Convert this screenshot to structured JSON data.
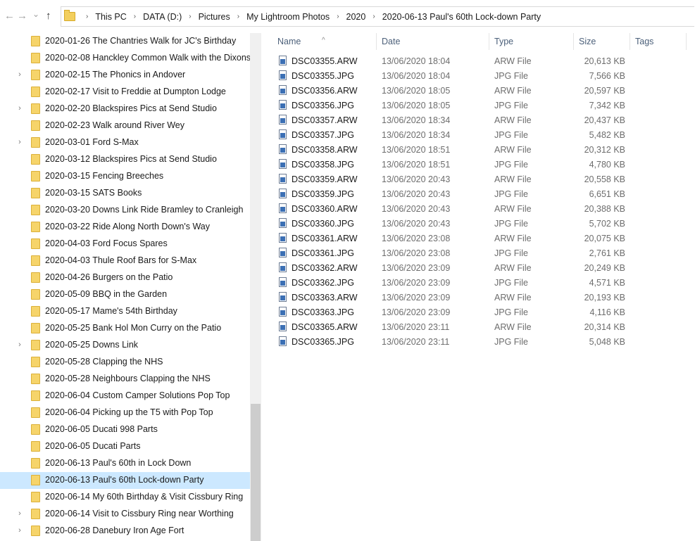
{
  "nav": {
    "back": "←",
    "forward": "→",
    "recent": "⌄",
    "up": "↑"
  },
  "breadcrumb": [
    "This PC",
    "DATA (D:)",
    "Pictures",
    "My Lightroom Photos",
    "2020",
    "2020-06-13 Paul's 60th Lock-down Party"
  ],
  "breadcrumb_sep": "›",
  "folders": [
    {
      "label": "2020-01-26 The Chantries Walk for JC's Birthday",
      "expandable": false
    },
    {
      "label": "2020-02-08 Hanckley Common Walk with the Dixons",
      "expandable": false
    },
    {
      "label": "2020-02-15 The Phonics in Andover",
      "expandable": true
    },
    {
      "label": "2020-02-17 Visit to Freddie at Dumpton Lodge",
      "expandable": false
    },
    {
      "label": "2020-02-20 Blackspires Pics at Send Studio",
      "expandable": true
    },
    {
      "label": "2020-02-23 Walk around River Wey",
      "expandable": false
    },
    {
      "label": "2020-03-01 Ford S-Max",
      "expandable": true
    },
    {
      "label": "2020-03-12 Blackspires Pics at Send Studio",
      "expandable": false
    },
    {
      "label": "2020-03-15 Fencing Breeches",
      "expandable": false
    },
    {
      "label": "2020-03-15 SATS Books",
      "expandable": false
    },
    {
      "label": "2020-03-20 Downs Link Ride Bramley to Cranleigh",
      "expandable": false
    },
    {
      "label": "2020-03-22 Ride Along North Down's Way",
      "expandable": false
    },
    {
      "label": "2020-04-03 Ford Focus Spares",
      "expandable": false
    },
    {
      "label": "2020-04-03 Thule Roof Bars for S-Max",
      "expandable": false
    },
    {
      "label": "2020-04-26 Burgers on the Patio",
      "expandable": false
    },
    {
      "label": "2020-05-09 BBQ in the Garden",
      "expandable": false
    },
    {
      "label": "2020-05-17 Mame's 54th Birthday",
      "expandable": false
    },
    {
      "label": "2020-05-25 Bank Hol Mon Curry on the Patio",
      "expandable": false
    },
    {
      "label": "2020-05-25 Downs Link",
      "expandable": true
    },
    {
      "label": "2020-05-28 Clapping the NHS",
      "expandable": false
    },
    {
      "label": "2020-05-28 Neighbours Clapping the NHS",
      "expandable": false
    },
    {
      "label": "2020-06-04 Custom Camper Solutions Pop Top",
      "expandable": false
    },
    {
      "label": "2020-06-04 Picking up the T5 with Pop Top",
      "expandable": false
    },
    {
      "label": "2020-06-05 Ducati 998 Parts",
      "expandable": false
    },
    {
      "label": "2020-06-05 Ducati Parts",
      "expandable": false
    },
    {
      "label": "2020-06-13 Paul's 60th in Lock Down",
      "expandable": false
    },
    {
      "label": "2020-06-13 Paul's 60th Lock-down Party",
      "expandable": false,
      "selected": true
    },
    {
      "label": "2020-06-14 My 60th Birthday & Visit Cissbury Ring",
      "expandable": false
    },
    {
      "label": "2020-06-14 Visit to Cissbury Ring near Worthing",
      "expandable": true
    },
    {
      "label": "2020-06-28 Danebury Iron Age Fort",
      "expandable": true
    }
  ],
  "columns": {
    "name": "Name",
    "date": "Date",
    "type": "Type",
    "size": "Size",
    "tags": "Tags"
  },
  "files": [
    {
      "name": "DSC03355.ARW",
      "date": "13/06/2020 18:04",
      "type": "ARW File",
      "size": "20,613 KB"
    },
    {
      "name": "DSC03355.JPG",
      "date": "13/06/2020 18:04",
      "type": "JPG File",
      "size": "7,566 KB"
    },
    {
      "name": "DSC03356.ARW",
      "date": "13/06/2020 18:05",
      "type": "ARW File",
      "size": "20,597 KB"
    },
    {
      "name": "DSC03356.JPG",
      "date": "13/06/2020 18:05",
      "type": "JPG File",
      "size": "7,342 KB"
    },
    {
      "name": "DSC03357.ARW",
      "date": "13/06/2020 18:34",
      "type": "ARW File",
      "size": "20,437 KB"
    },
    {
      "name": "DSC03357.JPG",
      "date": "13/06/2020 18:34",
      "type": "JPG File",
      "size": "5,482 KB"
    },
    {
      "name": "DSC03358.ARW",
      "date": "13/06/2020 18:51",
      "type": "ARW File",
      "size": "20,312 KB"
    },
    {
      "name": "DSC03358.JPG",
      "date": "13/06/2020 18:51",
      "type": "JPG File",
      "size": "4,780 KB"
    },
    {
      "name": "DSC03359.ARW",
      "date": "13/06/2020 20:43",
      "type": "ARW File",
      "size": "20,558 KB"
    },
    {
      "name": "DSC03359.JPG",
      "date": "13/06/2020 20:43",
      "type": "JPG File",
      "size": "6,651 KB"
    },
    {
      "name": "DSC03360.ARW",
      "date": "13/06/2020 20:43",
      "type": "ARW File",
      "size": "20,388 KB"
    },
    {
      "name": "DSC03360.JPG",
      "date": "13/06/2020 20:43",
      "type": "JPG File",
      "size": "5,702 KB"
    },
    {
      "name": "DSC03361.ARW",
      "date": "13/06/2020 23:08",
      "type": "ARW File",
      "size": "20,075 KB"
    },
    {
      "name": "DSC03361.JPG",
      "date": "13/06/2020 23:08",
      "type": "JPG File",
      "size": "2,761 KB"
    },
    {
      "name": "DSC03362.ARW",
      "date": "13/06/2020 23:09",
      "type": "ARW File",
      "size": "20,249 KB"
    },
    {
      "name": "DSC03362.JPG",
      "date": "13/06/2020 23:09",
      "type": "JPG File",
      "size": "4,571 KB"
    },
    {
      "name": "DSC03363.ARW",
      "date": "13/06/2020 23:09",
      "type": "ARW File",
      "size": "20,193 KB"
    },
    {
      "name": "DSC03363.JPG",
      "date": "13/06/2020 23:09",
      "type": "JPG File",
      "size": "4,116 KB"
    },
    {
      "name": "DSC03365.ARW",
      "date": "13/06/2020 23:11",
      "type": "ARW File",
      "size": "20,314 KB"
    },
    {
      "name": "DSC03365.JPG",
      "date": "13/06/2020 23:11",
      "type": "JPG File",
      "size": "5,048 KB"
    }
  ],
  "colors": {
    "selection": "#cce8ff",
    "folder": "#f6d46a",
    "header_text": "#4c607a"
  }
}
